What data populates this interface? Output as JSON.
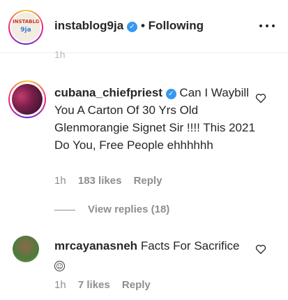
{
  "header": {
    "username": "instablog9ja",
    "verified_mark": "✓",
    "following_label": "• Following",
    "avatar_logo_top": "INSTABLOG",
    "avatar_logo_bottom": "9ja",
    "more_icon": "more-horizontal-icon"
  },
  "partial_time": "1h",
  "comments": [
    {
      "username": "cubana_chiefpriest",
      "verified_mark": "✓",
      "text": "Can I Waybill You A Carton Of 30 Yrs Old Glenmorangie Signet Sir !!!! This 2021 Do You, Free People ehhhhhh",
      "time": "1h",
      "likes": "183 likes",
      "reply_label": "Reply",
      "view_replies": "View replies (18)",
      "like_icon": "heart-outline-icon"
    },
    {
      "username": "mrcayanasneh",
      "text": "Facts For Sacrifice",
      "emoji": "☺",
      "time": "1h",
      "likes": "7 likes",
      "reply_label": "Reply",
      "like_icon": "heart-outline-icon"
    }
  ],
  "colors": {
    "verified": "#3897f0",
    "secondary_text": "#8e8e8e",
    "primary_text": "#262626"
  }
}
